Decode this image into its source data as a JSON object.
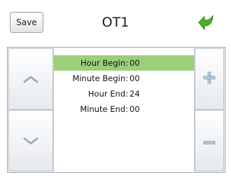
{
  "header": {
    "save_label": "Save",
    "title": "OT1"
  },
  "rows": [
    {
      "label": "Hour Begin:",
      "value": "00",
      "selected": true
    },
    {
      "label": "Minute Begin:",
      "value": "00",
      "selected": false
    },
    {
      "label": "Hour End:",
      "value": "24",
      "selected": false
    },
    {
      "label": "Minute End:",
      "value": "00",
      "selected": false
    }
  ],
  "colors": {
    "selected_row": "#9ccf7c",
    "back_arrow": "#4caf2a"
  },
  "icons": {
    "back": "back-arrow-icon",
    "up": "chevron-up-icon",
    "down": "chevron-down-icon",
    "plus": "plus-icon",
    "minus": "minus-icon"
  }
}
